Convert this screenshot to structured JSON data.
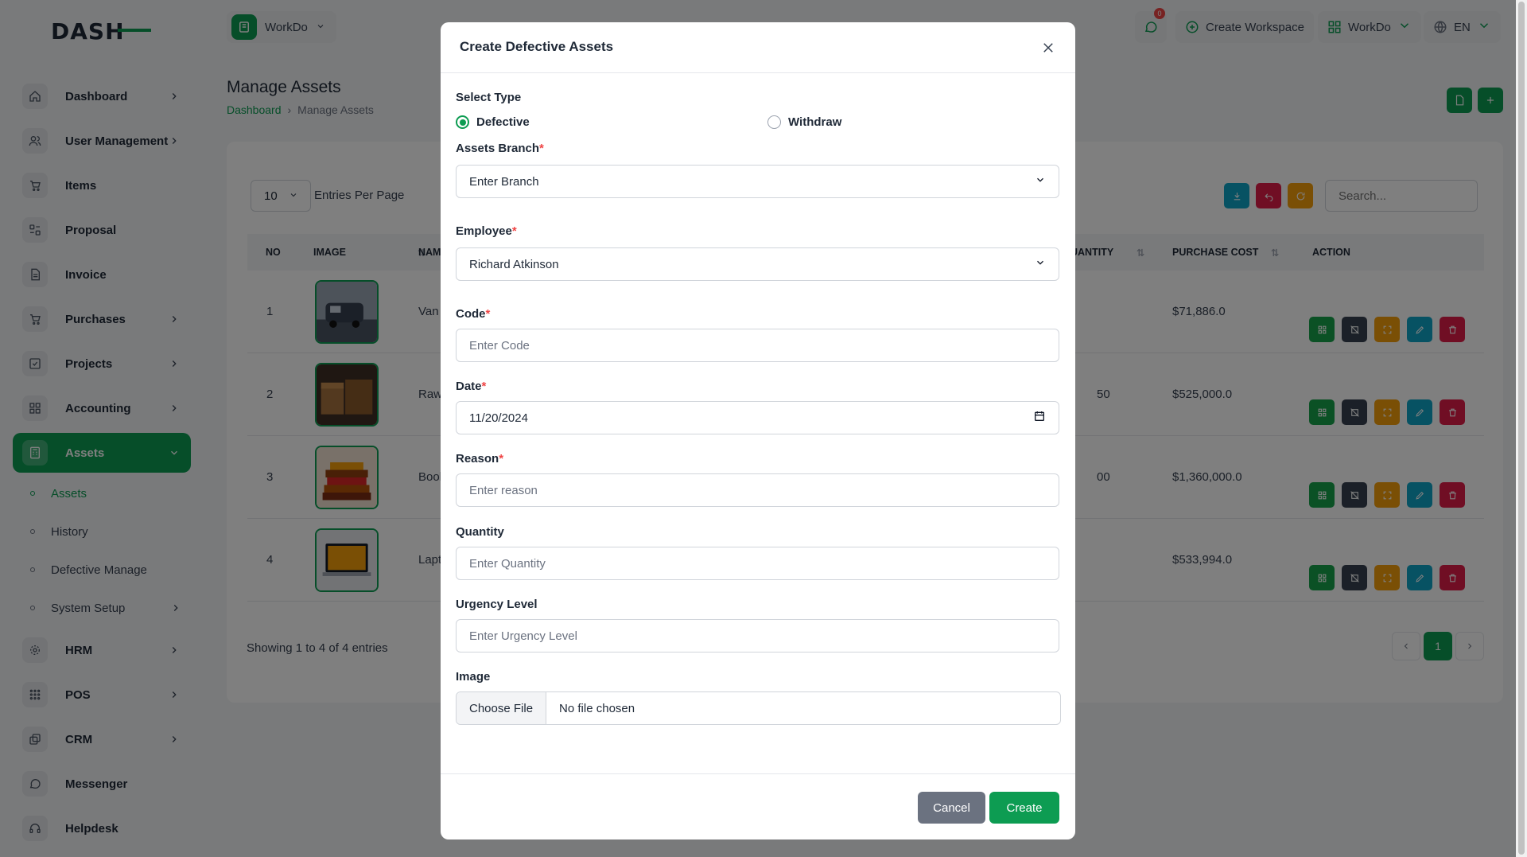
{
  "brand": {
    "logo_text": "DASH",
    "accent": "#0d9c52"
  },
  "topbar": {
    "workspace": "WorkDo",
    "notifications_count": "0",
    "create_workspace": "Create Workspace",
    "workspace_right": "WorkDo",
    "language": "EN"
  },
  "sidebar": {
    "items": [
      {
        "label": "Dashboard",
        "icon": "home-icon"
      },
      {
        "label": "User Management",
        "icon": "users-icon"
      },
      {
        "label": "Items",
        "icon": "cart-icon"
      },
      {
        "label": "Proposal",
        "icon": "proposal-icon"
      },
      {
        "label": "Invoice",
        "icon": "invoice-icon"
      },
      {
        "label": "Purchases",
        "icon": "cart-icon"
      },
      {
        "label": "Projects",
        "icon": "check-square-icon"
      },
      {
        "label": "Accounting",
        "icon": "grid-icon"
      },
      {
        "label": "Assets",
        "icon": "calculator-icon"
      },
      {
        "label": "HRM",
        "icon": "hrm-icon"
      },
      {
        "label": "POS",
        "icon": "dots-grid-icon"
      },
      {
        "label": "CRM",
        "icon": "layers-icon"
      },
      {
        "label": "Messenger",
        "icon": "chat-icon"
      },
      {
        "label": "Helpdesk",
        "icon": "headphones-icon"
      }
    ],
    "sub_items": [
      "Assets",
      "History",
      "Defective Manage",
      "System Setup"
    ]
  },
  "page": {
    "title": "Manage Assets",
    "breadcrumb": {
      "home": "Dashboard",
      "current": "Manage Assets"
    }
  },
  "table": {
    "per_page": "10",
    "per_page_label": "Entries Per Page",
    "search_placeholder": "Search...",
    "columns": [
      "NO",
      "IMAGE",
      "NAM",
      "UANTITY",
      "PURCHASE COST",
      "ACTION"
    ],
    "rows": [
      {
        "no": "1",
        "name": "Van",
        "qty": "",
        "cost": "$71,886.0"
      },
      {
        "no": "2",
        "name": "Raw",
        "qty": "50",
        "cost": "$525,000.0"
      },
      {
        "no": "3",
        "name": "Bool",
        "qty": "00",
        "cost": "$1,360,000.0"
      },
      {
        "no": "4",
        "name": "Lapt",
        "qty": "",
        "cost": "$533,994.0"
      }
    ],
    "showing": "Showing 1 to 4 of 4 entries",
    "current_page": "1"
  },
  "modal": {
    "title": "Create Defective Assets",
    "select_type_label": "Select Type",
    "type_options": [
      "Defective",
      "Withdraw"
    ],
    "selected_type": "Defective",
    "branch_label": "Assets Branch",
    "branch_value": "Enter Branch",
    "employee_label": "Employee",
    "employee_value": "Richard Atkinson",
    "code_label": "Code",
    "code_placeholder": "Enter Code",
    "date_label": "Date",
    "date_value": "11/20/2024",
    "reason_label": "Reason",
    "reason_placeholder": "Enter reason",
    "quantity_label": "Quantity",
    "quantity_placeholder": "Enter Quantity",
    "urgency_label": "Urgency Level",
    "urgency_placeholder": "Enter Urgency Level",
    "image_label": "Image",
    "file_button": "Choose File",
    "file_status": "No file chosen",
    "required_mark": "*",
    "cancel": "Cancel",
    "create": "Create"
  }
}
